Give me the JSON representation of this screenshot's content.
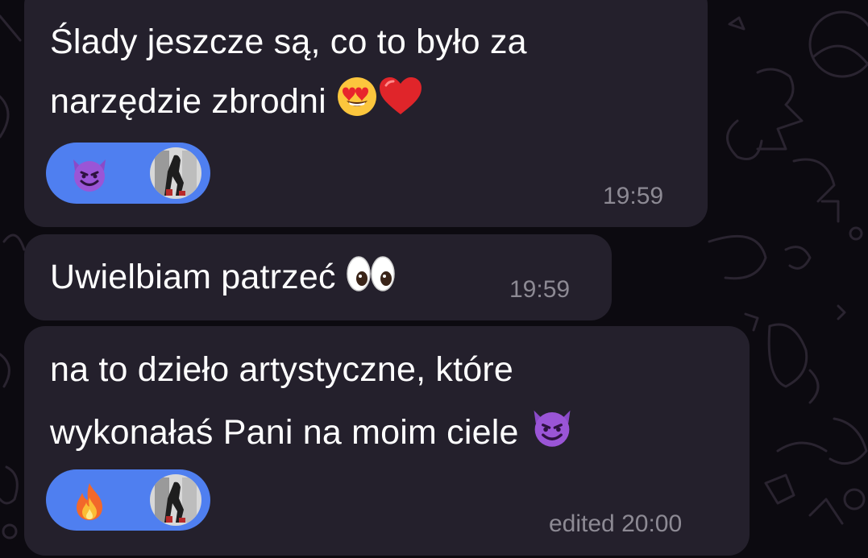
{
  "chat": {
    "messages": [
      {
        "line1": "Ślady jeszcze są, co to było za",
        "line2": "narzędzie zbrodni",
        "line2_emojis": [
          "smiling-face-with-heart-eyes",
          "red-heart"
        ],
        "reaction": {
          "emoji": "smiling-face-with-horns",
          "has_avatar": true
        },
        "time": "19:59"
      },
      {
        "line1": "Uwielbiam patrzeć",
        "line1_emojis": [
          "eyes"
        ],
        "time": "19:59"
      },
      {
        "line1": "na to dzieło artystyczne, które",
        "line2": "wykonałaś Pani na moim ciele",
        "line2_emojis": [
          "smiling-face-with-horns"
        ],
        "reaction": {
          "emoji": "fire",
          "has_avatar": true
        },
        "time": "edited 20:00"
      }
    ]
  },
  "colors": {
    "background": "#0c0a10",
    "bubble": "#24202c",
    "reaction_pill": "#4f7ff0",
    "timestamp": "#8d8a94",
    "text": "#ffffff"
  }
}
